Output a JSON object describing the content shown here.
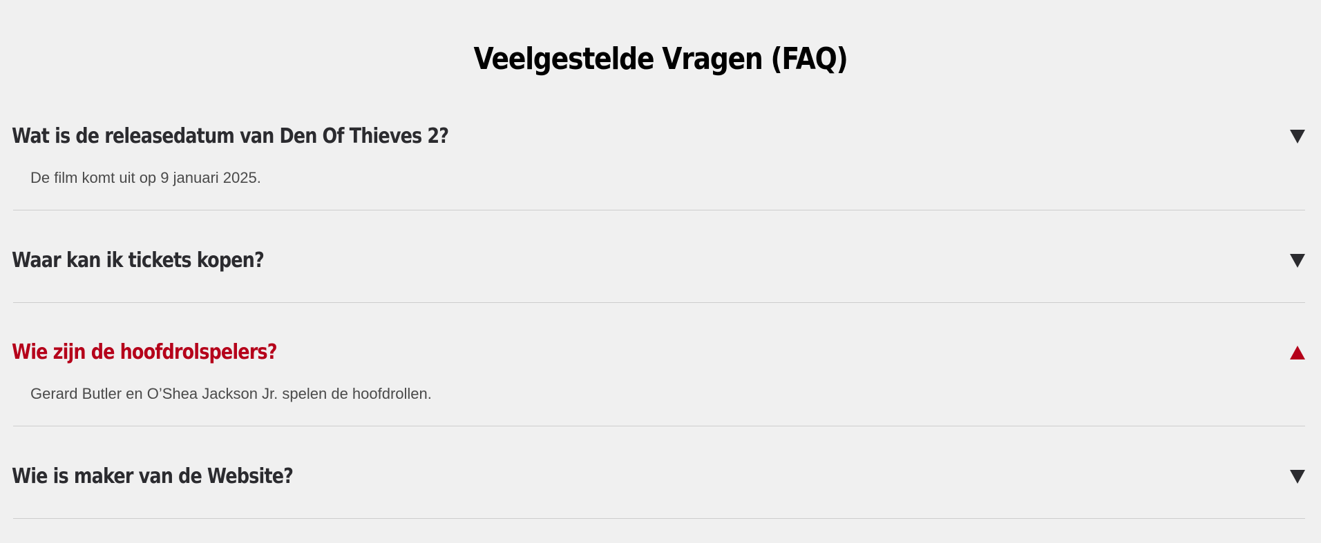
{
  "faq": {
    "title": "Veelgestelde Vragen (FAQ)",
    "colors": {
      "background": "#f0f0f0",
      "question": "#2b2b2f",
      "active": "#b5001a",
      "answer": "#4a4a4a",
      "divider": "#cdcdcd"
    },
    "items": [
      {
        "question": "Wat is de releasedatum van Den Of Thieves 2?",
        "answer": "De film komt uit op 9 januari 2025.",
        "expanded": true,
        "arrow_icon": "triangle-down-icon"
      },
      {
        "question": "Waar kan ik tickets kopen?",
        "answer": "",
        "expanded": false,
        "arrow_icon": "triangle-down-icon"
      },
      {
        "question": "Wie zijn de hoofdrolspelers?",
        "answer": "Gerard Butler en O’Shea Jackson Jr. spelen de hoofdrollen.",
        "expanded": true,
        "arrow_icon": "triangle-up-icon"
      },
      {
        "question": "Wie is maker van de Website?",
        "answer": "",
        "expanded": false,
        "arrow_icon": "triangle-down-icon"
      }
    ]
  }
}
